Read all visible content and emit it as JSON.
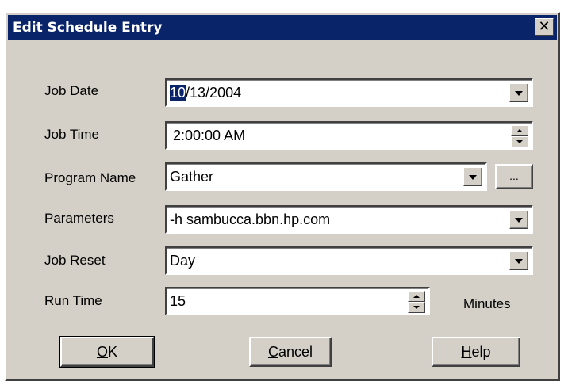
{
  "dialog": {
    "title": "Edit Schedule Entry",
    "close_glyph": "✕"
  },
  "fields": {
    "job_date": {
      "label": "Job Date",
      "value_selected": "10",
      "value_rest": "/13/2004"
    },
    "job_time": {
      "label": "Job Time",
      "value": "2:00:00 AM"
    },
    "program_name": {
      "label": "Program Name",
      "value": "Gather",
      "browse_label": "..."
    },
    "parameters": {
      "label": "Parameters",
      "value": "-h sambucca.bbn.hp.com"
    },
    "job_reset": {
      "label": "Job Reset",
      "value": "Day"
    },
    "run_time": {
      "label": "Run Time",
      "value": "15",
      "unit": "Minutes"
    }
  },
  "buttons": {
    "ok": {
      "mnemonic": "O",
      "rest": "K"
    },
    "cancel": {
      "mnemonic": "C",
      "rest": "ancel"
    },
    "help": {
      "mnemonic": "H",
      "rest": "elp"
    }
  },
  "colors": {
    "titlebar": "#0a246a",
    "face": "#d4d0c8",
    "selection": "#0a246a"
  }
}
